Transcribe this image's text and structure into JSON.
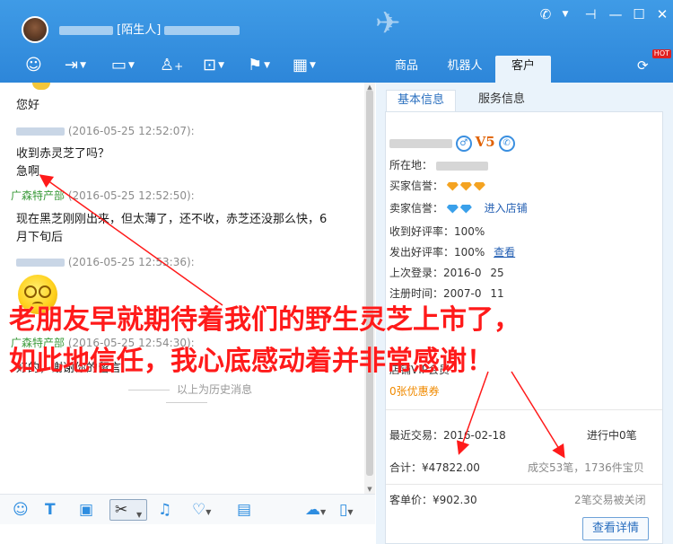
{
  "header": {
    "contact_tag": "[陌生人]",
    "tabs": [
      {
        "label": "商品"
      },
      {
        "label": "机器人"
      },
      {
        "label": "客户"
      }
    ],
    "hot_badge": "HOT"
  },
  "chat": {
    "messages": [
      {
        "text": "您好"
      },
      {
        "meta": "(2016-05-25 12:52:07):"
      },
      {
        "text": "收到赤灵芝了吗？"
      },
      {
        "text": "急啊"
      },
      {
        "sender": "广森特产部",
        "meta": "(2016-05-25 12:52:50):"
      },
      {
        "text": "现在黑芝刚刚出来，但太薄了，还不收，赤芝还没那么快，6"
      },
      {
        "text": "月下旬后"
      },
      {
        "meta": "(2016-05-25 12:53:36):"
      },
      {
        "sender": "广森特产部",
        "meta": "(2016-05-25 12:54:30):"
      },
      {
        "text": "好的，谢谢你的留言"
      }
    ],
    "history_separator": "以上为历史消息"
  },
  "side": {
    "tabs": [
      {
        "label": "基本信息"
      },
      {
        "label": "服务信息"
      }
    ],
    "level_badge": "V5",
    "location_label": "所在地：",
    "buyer_credit_label": "买家信誉：",
    "seller_credit_label": "卖家信誉：",
    "enter_shop": "进入店铺",
    "received_good_rate": "收到好评率：100%",
    "sent_good_rate": "发出好评率：100%",
    "view_link": "查看",
    "last_login": "上次登录：2016-0",
    "last_login_tail": "25",
    "register_time": "注册时间：2007-0",
    "register_tail": "11",
    "vip_label": "店铺VIP会员",
    "coupon": "0张优惠券",
    "recent_trade_label": "最近交易：",
    "recent_trade_date": "2016-02-18",
    "in_progress": "进行中0笔",
    "total_label": "合计：¥47822.00",
    "deals": "成交53笔，1736件宝贝",
    "avg_price": "客单价：¥902.30",
    "closed": "2笔交易被关闭",
    "detail_button": "查看详情"
  },
  "overlay": {
    "line1": "老朋友早就期待着我们的野生灵芝上市了，",
    "line2": "如此地信任，我心底感动着并非常感谢！",
    "color": "#ff1a1a"
  },
  "colors": {
    "header_blue": "#2d86d9",
    "seller_green": "#3a9a3a",
    "link_blue": "#2560b3",
    "orange": "#f08a00"
  }
}
